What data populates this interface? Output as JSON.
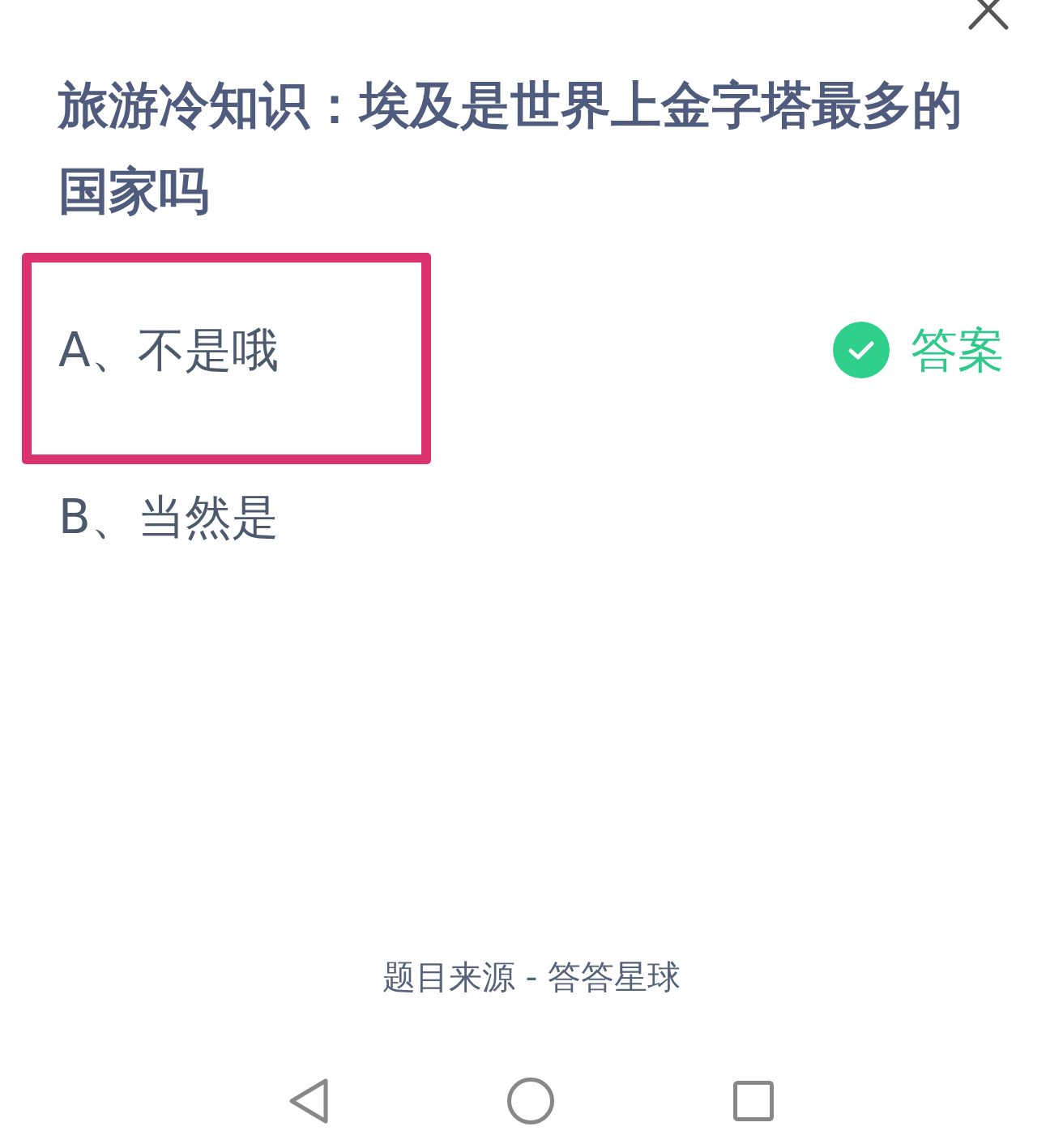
{
  "question": {
    "title": "旅游冷知识：埃及是世界上金字塔最多的国家吗"
  },
  "options": [
    {
      "label": "A、不是哦",
      "highlighted": true,
      "answer_tag": "答案"
    },
    {
      "label": "B、当然是",
      "highlighted": false
    }
  ],
  "footer": {
    "source": "题目来源 - 答答星球"
  }
}
